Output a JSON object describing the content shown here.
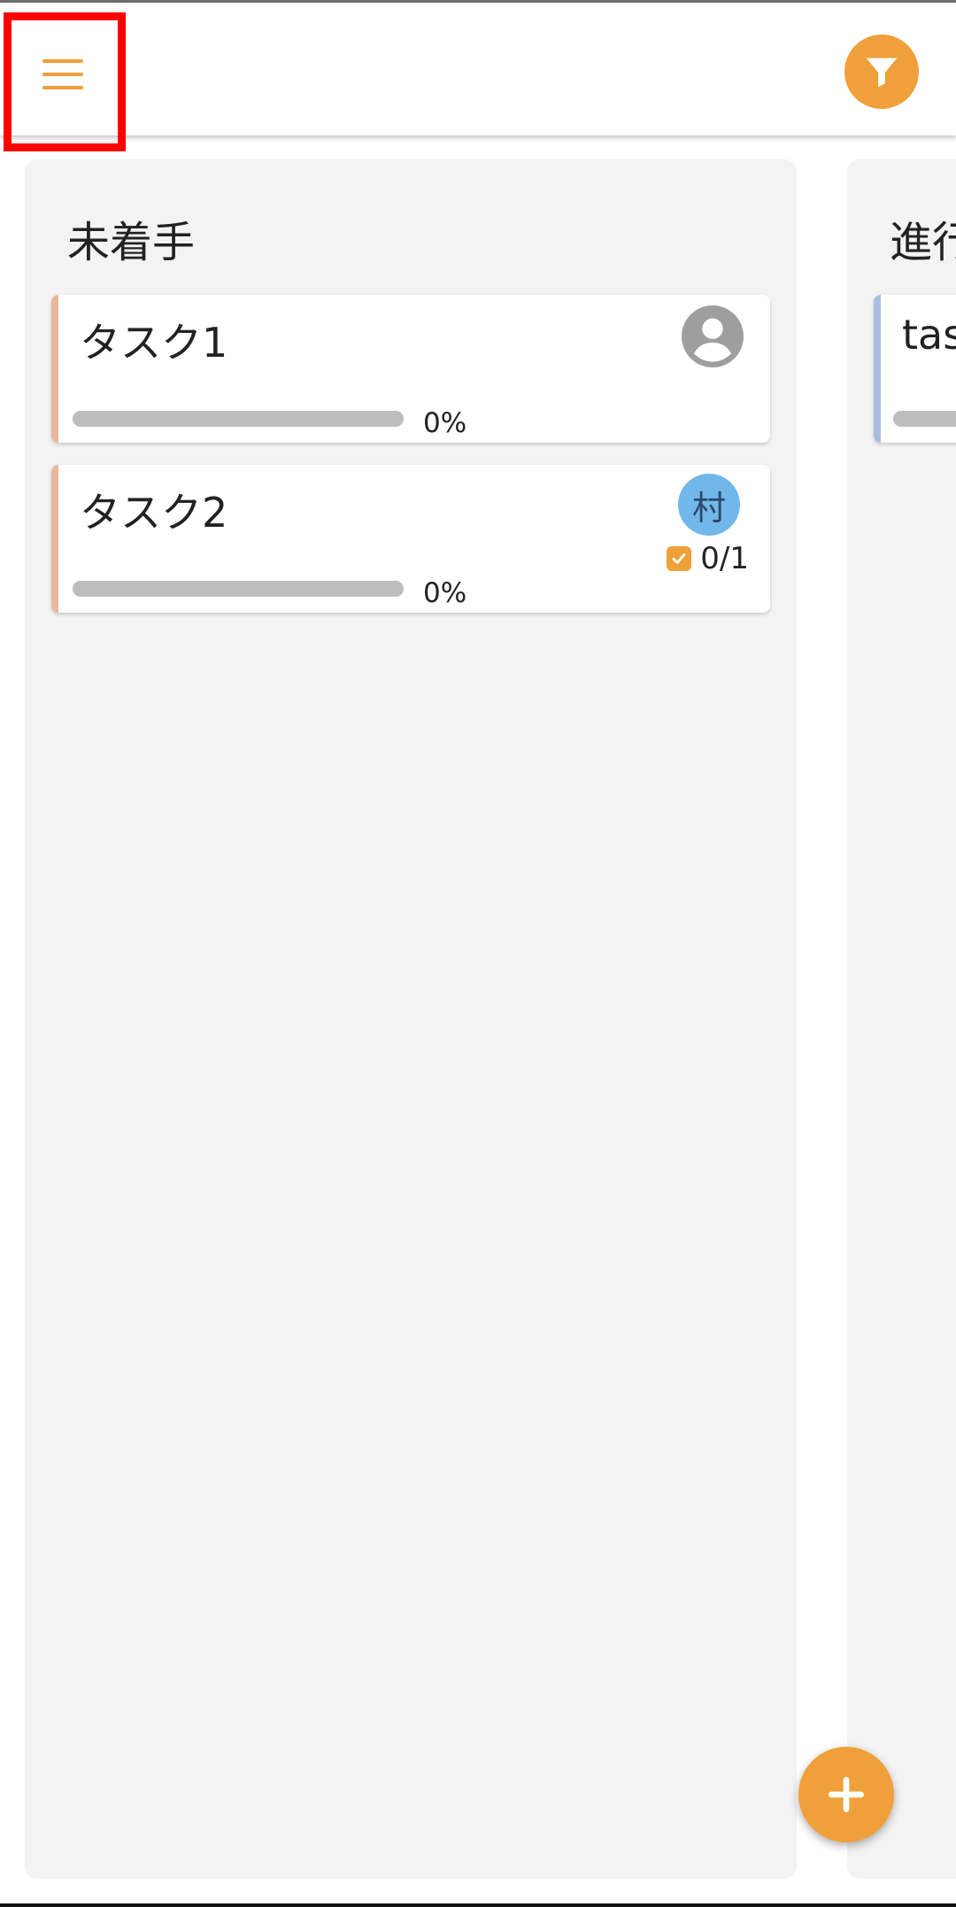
{
  "colors": {
    "accent": "#f0a03a",
    "column_bg": "#f3f3f3",
    "todo_card_accent": "#ebb79a",
    "in_progress_card_accent": "#a9bfe0",
    "avatar_default": "#9e9e9e",
    "avatar_initial_bg": "#72b7ea",
    "highlight": "#ff0000"
  },
  "header": {
    "menu_icon": "hamburger-menu-icon",
    "filter_icon": "funnel-filter-icon"
  },
  "columns": [
    {
      "title": "未着手",
      "cards": [
        {
          "title": "タスク1",
          "progress": 0,
          "progress_label": "0%",
          "assignee": "default-avatar-icon"
        },
        {
          "title": "タスク2",
          "progress": 0,
          "progress_label": "0%",
          "assignee_initial": "村",
          "checklist": "0/1"
        }
      ]
    },
    {
      "title": "進行",
      "cards": [
        {
          "title": "tas"
        }
      ]
    }
  ],
  "fab": {
    "icon": "plus-icon"
  }
}
